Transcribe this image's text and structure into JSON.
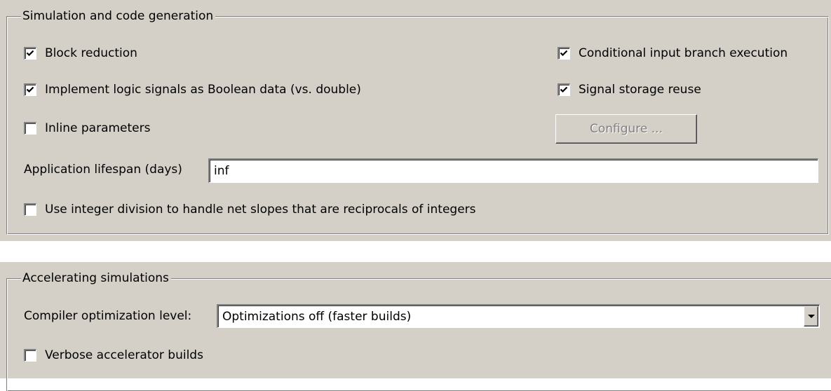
{
  "simulation": {
    "title": "Simulation and code generation",
    "block_reduction": {
      "label": "Block reduction",
      "checked": true
    },
    "conditional_input": {
      "label": "Conditional input branch execution",
      "checked": true
    },
    "boolean_logic": {
      "label": "Implement logic signals as Boolean data (vs. double)",
      "checked": true
    },
    "signal_storage": {
      "label": "Signal storage reuse",
      "checked": true
    },
    "inline_params": {
      "label": "Inline parameters",
      "checked": false
    },
    "configure_button": {
      "label": "Configure ...",
      "enabled": false
    },
    "lifespan": {
      "label": "Application lifespan (days)",
      "value": "inf"
    },
    "integer_division": {
      "label": "Use integer division to handle net slopes that are reciprocals of integers",
      "checked": false
    }
  },
  "accelerating": {
    "title": "Accelerating simulations",
    "compiler_opt": {
      "label": "Compiler optimization level:",
      "selected": "Optimizations off (faster builds)"
    },
    "verbose_builds": {
      "label": "Verbose accelerator builds",
      "checked": false
    }
  },
  "colors": {
    "panel_bg": "#d4d0c8",
    "field_bg": "#ffffff",
    "disabled_text": "#808080"
  }
}
